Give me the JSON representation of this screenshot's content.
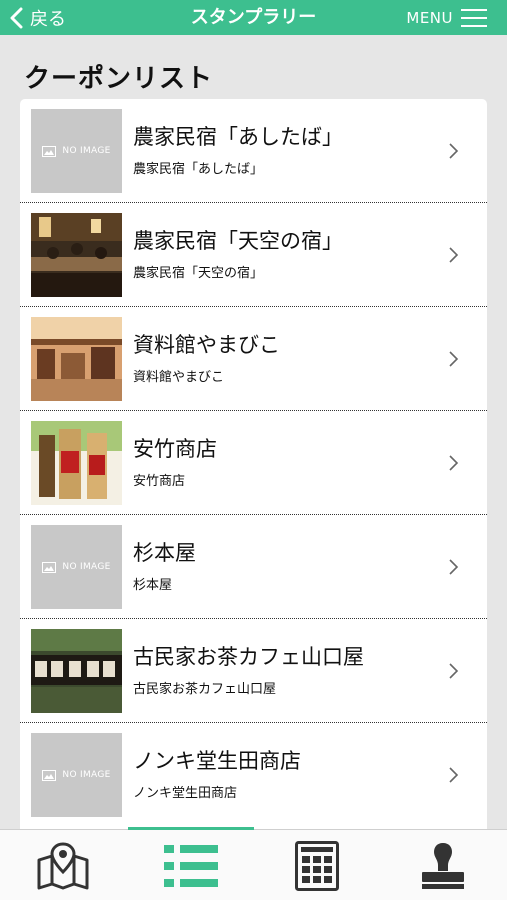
{
  "header": {
    "back_label": "戻る",
    "title": "スタンプラリー",
    "menu_label": "MENU"
  },
  "page_title": "クーポンリスト",
  "no_image_text": "NO IMAGE",
  "items": [
    {
      "title": "農家民宿「あしたば」",
      "subtitle": "農家民宿「あしたば」",
      "thumbnail": "no-image"
    },
    {
      "title": "農家民宿「天空の宿」",
      "subtitle": "農家民宿「天空の宿」",
      "thumbnail": "photo-dining-room"
    },
    {
      "title": "資料館やまびこ",
      "subtitle": "資料館やまびこ",
      "thumbnail": "photo-museum-interior"
    },
    {
      "title": "安竹商店",
      "subtitle": "安竹商店",
      "thumbnail": "photo-bottles"
    },
    {
      "title": "杉本屋",
      "subtitle": "杉本屋",
      "thumbnail": "no-image"
    },
    {
      "title": "古民家お茶カフェ山口屋",
      "subtitle": "古民家お茶カフェ山口屋",
      "thumbnail": "photo-cafe-signboard"
    },
    {
      "title": "ノンキ堂生田商店",
      "subtitle": "ノンキ堂生田商店",
      "thumbnail": "no-image"
    }
  ],
  "tabbar": {
    "tabs": [
      {
        "name": "map",
        "icon": "map-pin-icon"
      },
      {
        "name": "list",
        "icon": "list-icon",
        "active": true
      },
      {
        "name": "stamp-card",
        "icon": "stamp-card-icon"
      },
      {
        "name": "stamp",
        "icon": "stamp-icon"
      }
    ]
  },
  "colors": {
    "accent": "#3dbf8f",
    "background": "#e6e6e6",
    "no_image_bg": "#c8c8c8"
  }
}
